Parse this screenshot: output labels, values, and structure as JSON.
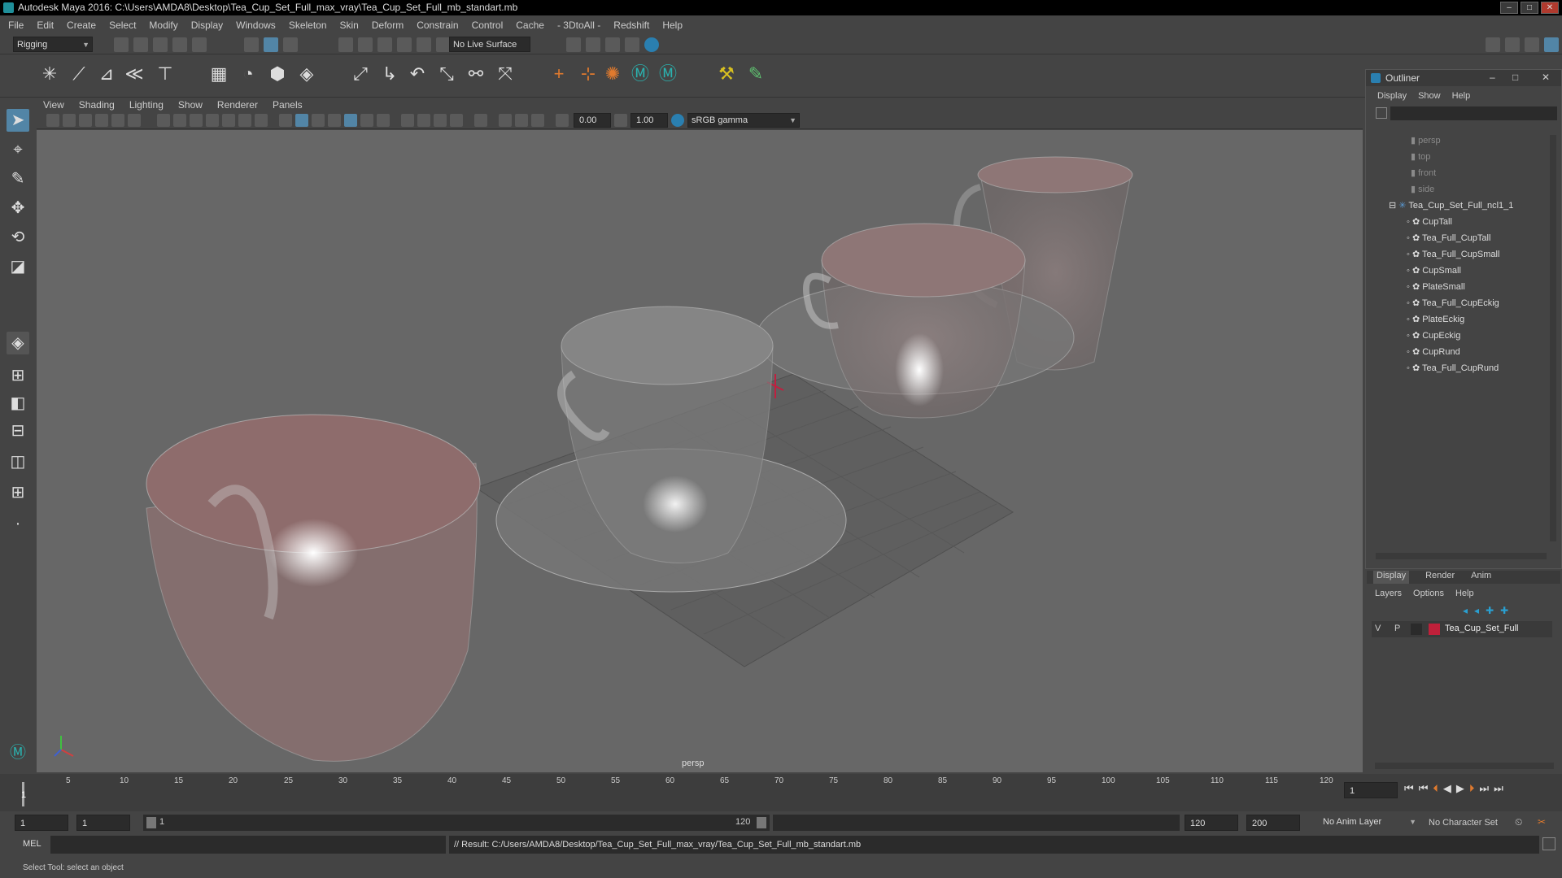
{
  "window": {
    "title": "Autodesk Maya 2016: C:\\Users\\AMDA8\\Desktop\\Tea_Cup_Set_Full_max_vray\\Tea_Cup_Set_Full_mb_standart.mb"
  },
  "menu": [
    "File",
    "Edit",
    "Create",
    "Select",
    "Modify",
    "Display",
    "Windows",
    "Skeleton",
    "Skin",
    "Deform",
    "Constrain",
    "Control",
    "Cache",
    "- 3DtoAll -",
    "Redshift",
    "Help"
  ],
  "statusline": {
    "mode": "Rigging",
    "live_surface": "No Live Surface"
  },
  "viewport": {
    "menu": [
      "View",
      "Shading",
      "Lighting",
      "Show",
      "Renderer",
      "Panels"
    ],
    "field1": "0.00",
    "field2": "1.00",
    "colorspace": "sRGB gamma",
    "camera_label": "persp"
  },
  "outliner": {
    "title": "Outliner",
    "menu": [
      "Display",
      "Show",
      "Help"
    ],
    "cameras": [
      "persp",
      "top",
      "front",
      "side"
    ],
    "group": "Tea_Cup_Set_Full_ncl1_1",
    "children": [
      "CupTall",
      "Tea_Full_CupTall",
      "Tea_Full_CupSmall",
      "CupSmall",
      "PlateSmall",
      "Tea_Full_CupEckig",
      "PlateEckig",
      "CupEckig",
      "CupRund",
      "Tea_Full_CupRund"
    ]
  },
  "layers": {
    "tabs": [
      "Display",
      "Render",
      "Anim"
    ],
    "menu": [
      "Layers",
      "Options",
      "Help"
    ],
    "layer": {
      "v": "V",
      "p": "P",
      "name": "Tea_Cup_Set_Full",
      "color": "#c0203a"
    }
  },
  "timeline": {
    "ticks": [
      "5",
      "10",
      "15",
      "20",
      "25",
      "30",
      "35",
      "40",
      "45",
      "50",
      "55",
      "60",
      "65",
      "70",
      "75",
      "80",
      "85",
      "90",
      "95",
      "100",
      "105",
      "110",
      "115",
      "120"
    ],
    "current_marker": "1",
    "current_field": "1"
  },
  "range": {
    "start": "1",
    "start2": "1",
    "slider_start": "1",
    "slider_end": "120",
    "end": "120",
    "end2": "200",
    "anim_layer": "No Anim Layer",
    "char_set": "No Character Set"
  },
  "cmd": {
    "lang": "MEL",
    "result": "// Result: C:/Users/AMDA8/Desktop/Tea_Cup_Set_Full_max_vray/Tea_Cup_Set_Full_mb_standart.mb"
  },
  "help": "Select Tool: select an object",
  "colors": {
    "accent": "#5285a6",
    "layer_red": "#c0203a",
    "title_bg": "#000000"
  }
}
